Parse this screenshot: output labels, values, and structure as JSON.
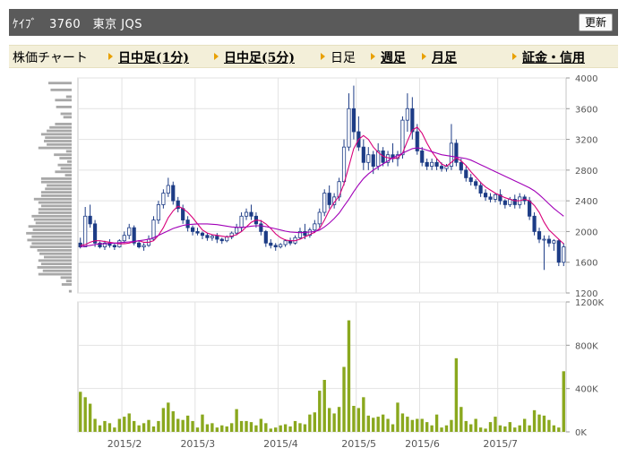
{
  "header": {
    "title": "ｹｲﾌﾞ　3760　東京 JQS",
    "refresh_label": "更新"
  },
  "nav": {
    "title": "株価チャート",
    "items": [
      {
        "label": "日中足(1分)",
        "link": true
      },
      {
        "label": "日中足(5分)",
        "link": true
      },
      {
        "label": "日足",
        "link": false
      },
      {
        "label": "週足",
        "link": true
      },
      {
        "label": "月足",
        "link": true
      },
      {
        "label": "証金・信用",
        "link": true
      }
    ]
  },
  "colors": {
    "up": "#ffffff",
    "down": "#1d3c86",
    "ma_short": "#d8007a",
    "ma_long": "#a100b8",
    "volume": "#8aa81e",
    "volume_profile": "#a8a8a8"
  },
  "chart_data": [
    {
      "type": "candlestick",
      "title": "",
      "x_ticks": [
        "2015/2",
        "2015/3",
        "2015/4",
        "2015/5",
        "2015/6",
        "2015/7"
      ],
      "x_tick_positions": [
        9,
        24,
        41,
        57,
        70,
        86
      ],
      "ylim": [
        1200,
        4000
      ],
      "y_ticks": [
        1200,
        1600,
        2000,
        2400,
        2800,
        3200,
        3600,
        4000
      ],
      "grid": true,
      "series": [
        {
          "name": "",
          "kind": "ohlc",
          "values": [
            [
              1850,
              1920,
              1780,
              1800
            ],
            [
              1800,
              2320,
              1800,
              2200
            ],
            [
              2200,
              2350,
              2050,
              2100
            ],
            [
              2100,
              2150,
              1800,
              1850
            ],
            [
              1850,
              1870,
              1780,
              1800
            ],
            [
              1800,
              1880,
              1760,
              1850
            ],
            [
              1850,
              1900,
              1790,
              1820
            ],
            [
              1820,
              1840,
              1760,
              1800
            ],
            [
              1800,
              1900,
              1790,
              1880
            ],
            [
              1880,
              2000,
              1850,
              1950
            ],
            [
              1950,
              2100,
              1900,
              2050
            ],
            [
              2050,
              2080,
              1820,
              1850
            ],
            [
              1850,
              1880,
              1780,
              1800
            ],
            [
              1800,
              1850,
              1750,
              1820
            ],
            [
              1820,
              1950,
              1800,
              1900
            ],
            [
              1900,
              2200,
              1880,
              2150
            ],
            [
              2150,
              2400,
              2100,
              2350
            ],
            [
              2350,
              2550,
              2300,
              2500
            ],
            [
              2500,
              2700,
              2450,
              2600
            ],
            [
              2600,
              2650,
              2350,
              2400
            ],
            [
              2400,
              2450,
              2250,
              2300
            ],
            [
              2300,
              2350,
              2100,
              2150
            ],
            [
              2150,
              2200,
              2000,
              2050
            ],
            [
              2050,
              2080,
              1950,
              2000
            ],
            [
              2000,
              2050,
              1950,
              1980
            ],
            [
              1980,
              2000,
              1900,
              1950
            ],
            [
              1950,
              1980,
              1880,
              1920
            ],
            [
              1920,
              1960,
              1880,
              1940
            ],
            [
              1940,
              1980,
              1850,
              1900
            ],
            [
              1900,
              1920,
              1840,
              1880
            ],
            [
              1880,
              1950,
              1860,
              1930
            ],
            [
              1930,
              2000,
              1900,
              1980
            ],
            [
              1980,
              2100,
              1950,
              2050
            ],
            [
              2050,
              2250,
              2000,
              2200
            ],
            [
              2200,
              2300,
              2150,
              2250
            ],
            [
              2250,
              2350,
              2150,
              2200
            ],
            [
              2200,
              2250,
              2050,
              2100
            ],
            [
              2100,
              2150,
              1950,
              2000
            ],
            [
              2000,
              2020,
              1800,
              1850
            ],
            [
              1850,
              1900,
              1780,
              1820
            ],
            [
              1820,
              1850,
              1750,
              1800
            ],
            [
              1800,
              1850,
              1780,
              1830
            ],
            [
              1830,
              1900,
              1800,
              1880
            ],
            [
              1880,
              1920,
              1820,
              1850
            ],
            [
              1850,
              1950,
              1830,
              1920
            ],
            [
              1920,
              2050,
              1900,
              2000
            ],
            [
              2000,
              2100,
              1900,
              1950
            ],
            [
              1950,
              2050,
              1920,
              2020
            ],
            [
              2020,
              2150,
              1980,
              2100
            ],
            [
              2100,
              2300,
              2050,
              2250
            ],
            [
              2250,
              2550,
              2200,
              2500
            ],
            [
              2500,
              2600,
              2300,
              2350
            ],
            [
              2350,
              2500,
              2300,
              2450
            ],
            [
              2450,
              2700,
              2400,
              2650
            ],
            [
              2650,
              3200,
              2600,
              3100
            ],
            [
              3100,
              3800,
              3050,
              3600
            ],
            [
              3600,
              3900,
              3200,
              3300
            ],
            [
              3300,
              3500,
              3050,
              3100
            ],
            [
              3100,
              3200,
              2800,
              2900
            ],
            [
              2900,
              3100,
              2800,
              3000
            ],
            [
              3000,
              3050,
              2750,
              2850
            ],
            [
              2850,
              3150,
              2800,
              3050
            ],
            [
              3050,
              3100,
              2850,
              2900
            ],
            [
              2900,
              3050,
              2850,
              3000
            ],
            [
              3000,
              3150,
              2900,
              2950
            ],
            [
              2950,
              3050,
              2850,
              3000
            ],
            [
              3000,
              3500,
              2950,
              3450
            ],
            [
              3450,
              3800,
              3300,
              3600
            ],
            [
              3600,
              3750,
              3200,
              3300
            ],
            [
              3300,
              3400,
              3000,
              3050
            ],
            [
              3050,
              3100,
              2850,
              2900
            ],
            [
              2900,
              2950,
              2800,
              2850
            ],
            [
              2850,
              2950,
              2800,
              2900
            ],
            [
              2900,
              2950,
              2800,
              2850
            ],
            [
              2850,
              2900,
              2780,
              2820
            ],
            [
              2820,
              2880,
              2780,
              2850
            ],
            [
              2850,
              3400,
              2800,
              3150
            ],
            [
              3150,
              3200,
              2850,
              2900
            ],
            [
              2900,
              2950,
              2750,
              2800
            ],
            [
              2800,
              2850,
              2650,
              2700
            ],
            [
              2700,
              2750,
              2600,
              2650
            ],
            [
              2650,
              2680,
              2550,
              2600
            ],
            [
              2600,
              2650,
              2450,
              2500
            ],
            [
              2500,
              2550,
              2400,
              2450
            ],
            [
              2450,
              2500,
              2380,
              2420
            ],
            [
              2420,
              2500,
              2380,
              2480
            ],
            [
              2480,
              2550,
              2350,
              2400
            ],
            [
              2400,
              2420,
              2300,
              2350
            ],
            [
              2350,
              2450,
              2320,
              2420
            ],
            [
              2420,
              2480,
              2300,
              2350
            ],
            [
              2350,
              2500,
              2300,
              2450
            ],
            [
              2450,
              2480,
              2350,
              2400
            ],
            [
              2400,
              2450,
              2150,
              2200
            ],
            [
              2200,
              2250,
              1950,
              2000
            ],
            [
              2000,
              2050,
              1850,
              1900
            ],
            [
              1900,
              1950,
              1500,
              1900
            ],
            [
              1900,
              1950,
              1800,
              1850
            ],
            [
              1850,
              1900,
              1750,
              1880
            ],
            [
              1880,
              1900,
              1550,
              1600
            ],
            [
              1600,
              1850,
              1550,
              1800
            ]
          ]
        },
        {
          "name": "",
          "kind": "line",
          "values": [
            1820,
            1830,
            1860,
            1880,
            1880,
            1870,
            1860,
            1850,
            1840,
            1840,
            1850,
            1870,
            1880,
            1860,
            1860,
            1880,
            1950,
            2050,
            2180,
            2270,
            2330,
            2300,
            2250,
            2180,
            2100,
            2020,
            1980,
            1960,
            1950,
            1940,
            1930,
            1940,
            1960,
            2000,
            2060,
            2120,
            2150,
            2140,
            2100,
            2040,
            1970,
            1920,
            1890,
            1880,
            1880,
            1900,
            1930,
            1960,
            1990,
            2040,
            2150,
            2280,
            2380,
            2460,
            2620,
            2850,
            3080,
            3200,
            3250,
            3200,
            3100,
            3030,
            2980,
            2960,
            2950,
            2960,
            3020,
            3180,
            3320,
            3360,
            3280,
            3150,
            3040,
            2950,
            2880,
            2850,
            2900,
            2960,
            2920,
            2860,
            2780,
            2710,
            2640,
            2580,
            2540,
            2500,
            2470,
            2440,
            2420,
            2400,
            2400,
            2420,
            2400,
            2340,
            2250,
            2120,
            2020,
            1960,
            1900,
            1840
          ]
        },
        {
          "name": "",
          "kind": "line",
          "values": [
            1800,
            1810,
            1820,
            1830,
            1840,
            1840,
            1845,
            1850,
            1855,
            1860,
            1865,
            1870,
            1880,
            1890,
            1900,
            1920,
            1950,
            1980,
            2010,
            2040,
            2060,
            2080,
            2090,
            2095,
            2100,
            2100,
            2100,
            2095,
            2090,
            2080,
            2070,
            2060,
            2055,
            2055,
            2060,
            2070,
            2075,
            2075,
            2065,
            2050,
            2035,
            2020,
            2005,
            1995,
            1990,
            1985,
            1990,
            1995,
            2000,
            2020,
            2060,
            2110,
            2170,
            2240,
            2330,
            2420,
            2520,
            2610,
            2690,
            2750,
            2800,
            2840,
            2880,
            2920,
            2960,
            2990,
            3020,
            3050,
            3080,
            3090,
            3080,
            3060,
            3040,
            3020,
            3000,
            2990,
            2980,
            2970,
            2960,
            2950,
            2930,
            2900,
            2870,
            2840,
            2810,
            2780,
            2750,
            2720,
            2690,
            2660,
            2630,
            2600,
            2570,
            2530,
            2480,
            2420,
            2360,
            2300,
            2250,
            2200
          ]
        }
      ],
      "volume_profile": [
        0.05,
        0.0,
        0.18,
        0.1,
        0.2,
        0.6,
        0.52,
        0.62,
        0.55,
        0.6,
        0.5,
        0.58,
        0.62,
        0.75,
        0.72,
        0.8,
        0.72,
        0.82,
        0.7,
        0.78,
        0.65,
        0.68,
        0.72,
        0.6,
        0.6,
        0.55,
        0.6,
        0.68,
        0.55,
        0.55,
        0.48,
        0.45,
        0.55,
        0.55,
        0.12,
        0.3,
        0.2,
        0.25,
        0.08,
        0.22,
        0.32,
        0.1,
        0.6,
        0.45,
        0.5,
        0.48,
        0.55,
        0.45,
        0.4,
        0.3,
        0.0,
        0.15,
        0.2,
        0.0,
        0.28,
        0.0,
        0.3,
        0.1,
        0.0,
        0.38,
        0.0,
        0.42,
        0.0
      ]
    },
    {
      "type": "bar",
      "title": "",
      "ylim": [
        0,
        1200000
      ],
      "y_ticks": [
        "0K",
        "400K",
        "800K",
        "1200K"
      ],
      "y_tick_values": [
        0,
        400000,
        800000,
        1200000
      ],
      "grid": true,
      "values": [
        370000,
        320000,
        260000,
        120000,
        60000,
        100000,
        80000,
        40000,
        120000,
        140000,
        170000,
        100000,
        60000,
        80000,
        110000,
        50000,
        100000,
        220000,
        270000,
        190000,
        120000,
        110000,
        150000,
        100000,
        40000,
        160000,
        70000,
        80000,
        40000,
        60000,
        50000,
        80000,
        210000,
        100000,
        100000,
        90000,
        60000,
        120000,
        80000,
        30000,
        40000,
        60000,
        70000,
        50000,
        100000,
        80000,
        70000,
        160000,
        180000,
        380000,
        480000,
        220000,
        170000,
        230000,
        600000,
        1030000,
        240000,
        220000,
        320000,
        150000,
        130000,
        140000,
        160000,
        120000,
        70000,
        270000,
        170000,
        140000,
        110000,
        120000,
        120000,
        90000,
        60000,
        160000,
        40000,
        60000,
        110000,
        680000,
        230000,
        100000,
        70000,
        120000,
        40000,
        30000,
        90000,
        140000,
        60000,
        50000,
        90000,
        40000,
        60000,
        120000,
        60000,
        200000,
        160000,
        150000,
        110000,
        60000,
        40000,
        560000
      ]
    }
  ]
}
